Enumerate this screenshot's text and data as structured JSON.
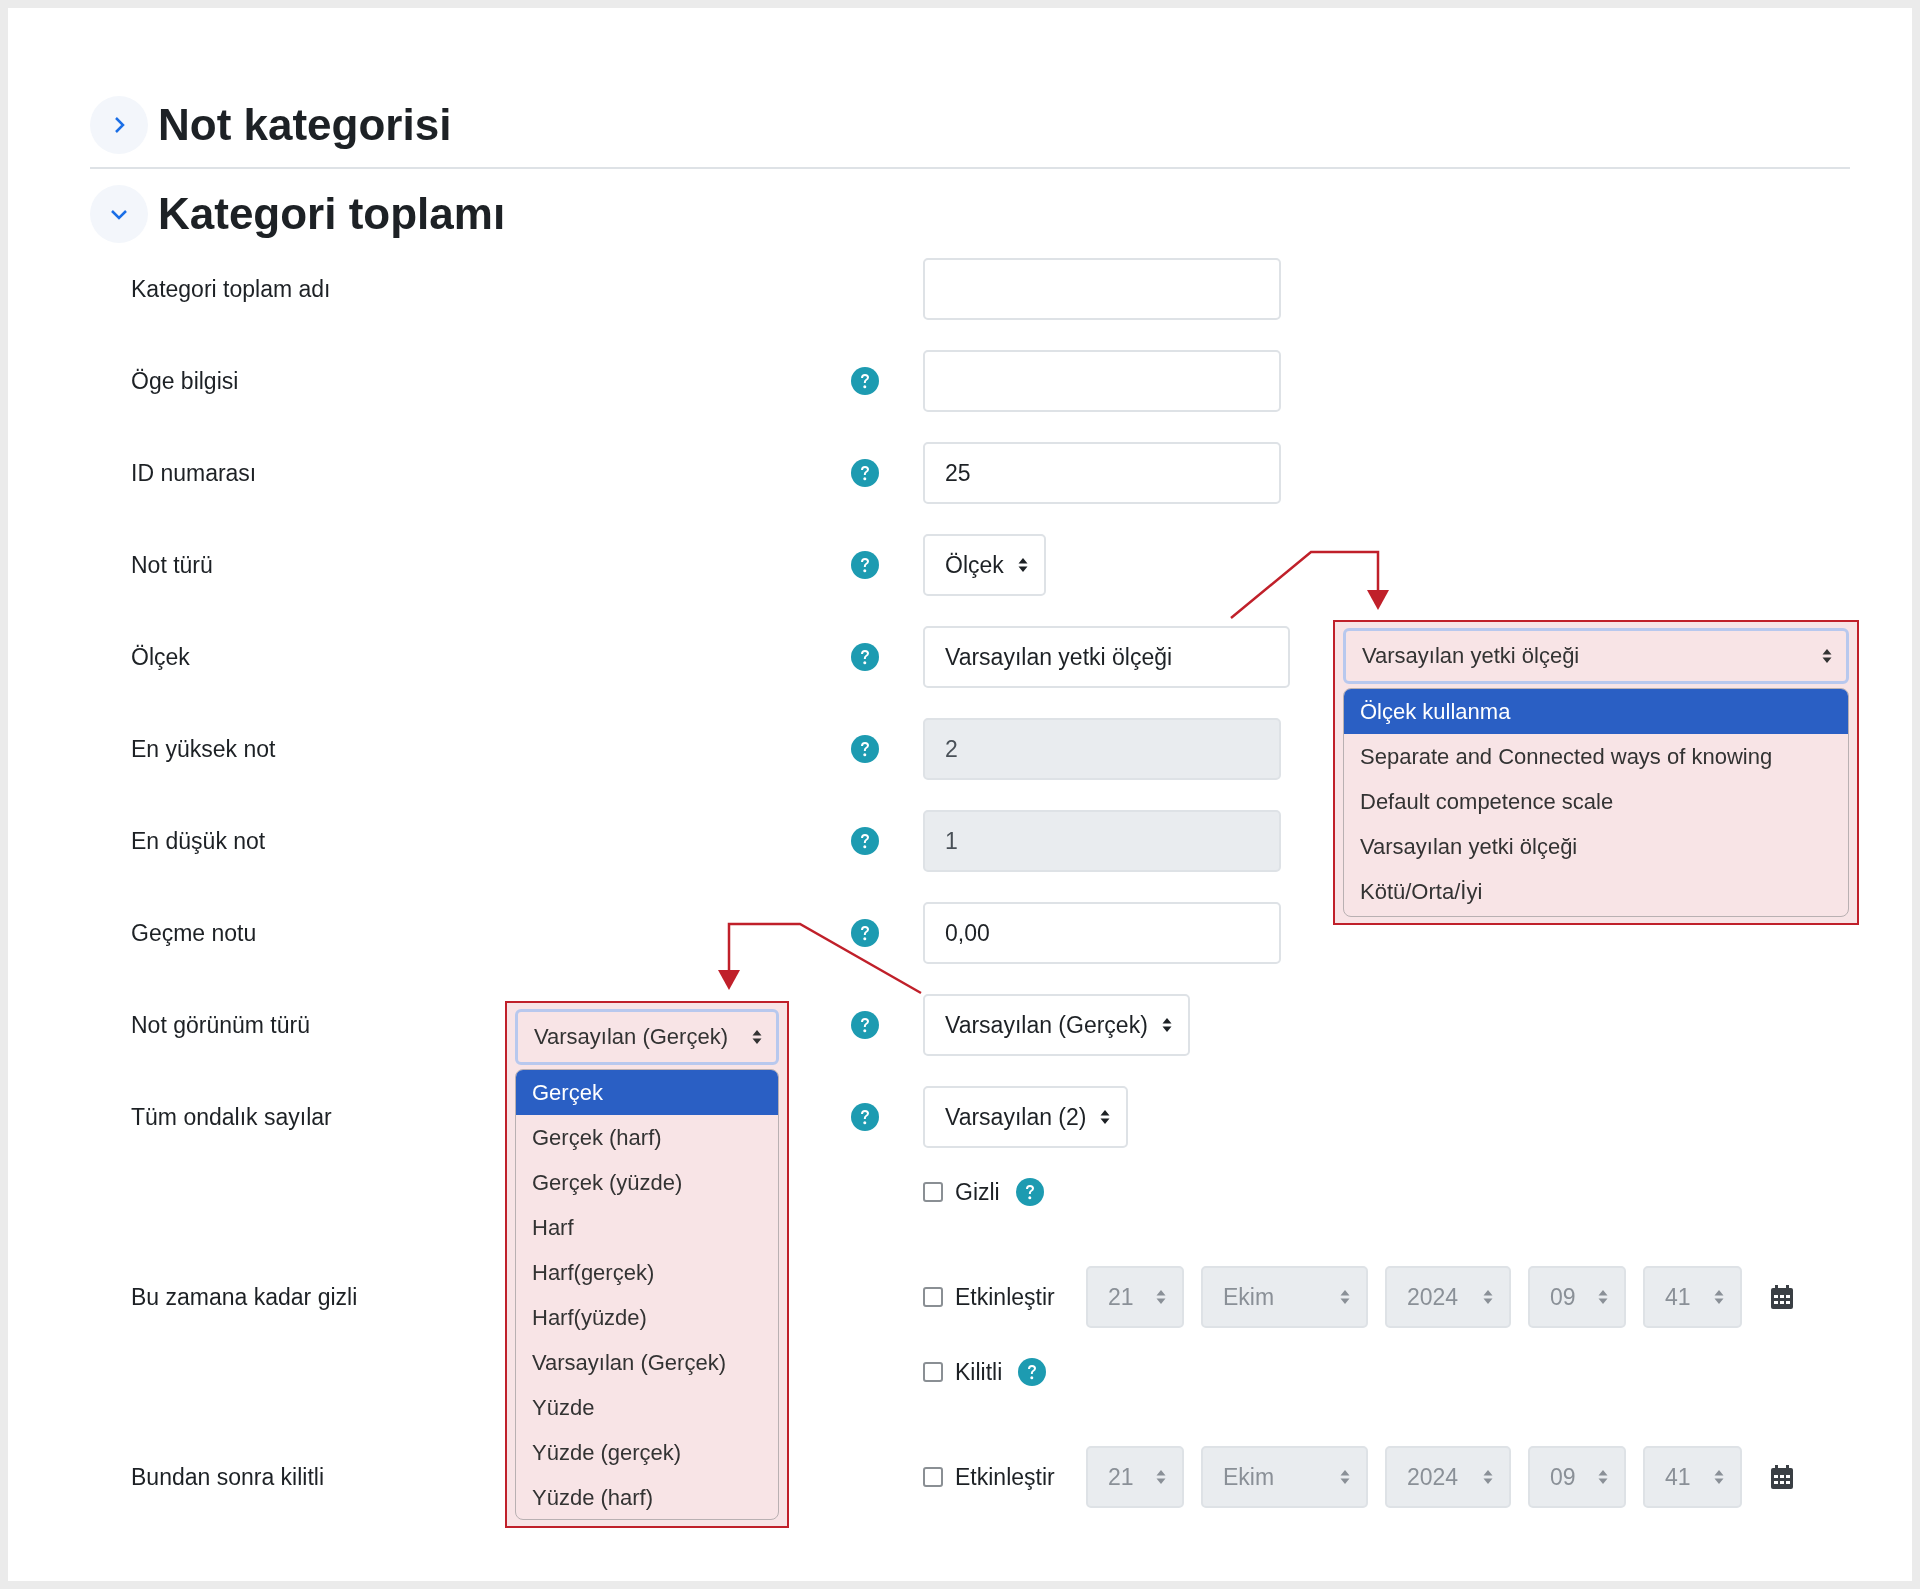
{
  "sections": [
    {
      "title": "Not kategorisi",
      "expanded": false
    },
    {
      "title": "Kategori toplamı",
      "expanded": true
    }
  ],
  "fields": [
    {
      "kind": "text",
      "label": "Kategori toplam adı",
      "help": false
    },
    {
      "kind": "text",
      "label": "Öge bilgisi",
      "help": true
    },
    {
      "kind": "text",
      "label": "ID numarası",
      "help": true,
      "value": "25"
    },
    {
      "kind": "select",
      "label": "Not türü",
      "help": true,
      "value": "Ölçek"
    },
    {
      "kind": "text",
      "label": "Ölçek",
      "help": true,
      "value": "Varsayılan yetki ölçeği"
    },
    {
      "kind": "text",
      "label": "En yüksek not",
      "help": true,
      "value": "2",
      "disabled": true
    },
    {
      "kind": "text",
      "label": "En düşük not",
      "help": true,
      "value": "1",
      "disabled": true
    },
    {
      "kind": "text",
      "label": "Geçme notu",
      "help": true,
      "value": "0,00"
    },
    {
      "kind": "select",
      "label": "Not görünüm türü",
      "help": true,
      "value": "Varsayılan (Gerçek)"
    },
    {
      "kind": "select",
      "label": "Tüm ondalık sayılar",
      "help": true,
      "value": "Varsayılan (2)"
    },
    {
      "kind": "checkbox",
      "text": "Gizli",
      "help": true,
      "checked": false
    },
    {
      "kind": "datetime",
      "label": "Bu zamana kadar gizli",
      "text": "Etkinleştir",
      "checked": false,
      "day": "21",
      "month": "Ekim",
      "year": "2024",
      "hour": "09",
      "minute": "41"
    },
    {
      "kind": "checkbox",
      "text": "Kilitli",
      "help": true,
      "checked": false
    },
    {
      "kind": "datetime",
      "label": "Bundan sonra kilitli",
      "text": "Etkinleştir",
      "checked": false,
      "day": "21",
      "month": "Ekim",
      "year": "2024",
      "hour": "09",
      "minute": "41"
    }
  ],
  "callouts": [
    {
      "value": "Varsayılan yetki ölçeği",
      "options": [
        {
          "label": "Ölçek kullanma",
          "highlighted": true
        },
        {
          "label": "Separate and Connected ways of knowing",
          "highlighted": false
        },
        {
          "label": "Default competence scale",
          "highlighted": false
        },
        {
          "label": "Varsayılan yetki ölçeği",
          "highlighted": false
        },
        {
          "label": "Kötü/Orta/İyi",
          "highlighted": false
        }
      ]
    },
    {
      "value": "Varsayılan (Gerçek)",
      "options": [
        {
          "label": "Gerçek",
          "highlighted": true
        },
        {
          "label": "Gerçek (harf)",
          "highlighted": false
        },
        {
          "label": "Gerçek (yüzde)",
          "highlighted": false
        },
        {
          "label": "Harf",
          "highlighted": false
        },
        {
          "label": "Harf(gerçek)",
          "highlighted": false
        },
        {
          "label": "Harf(yüzde)",
          "highlighted": false
        },
        {
          "label": "Varsayılan (Gerçek)",
          "highlighted": false
        },
        {
          "label": "Yüzde",
          "highlighted": false
        },
        {
          "label": "Yüzde (gerçek)",
          "highlighted": false
        },
        {
          "label": "Yüzde (harf)",
          "highlighted": false
        }
      ]
    }
  ]
}
